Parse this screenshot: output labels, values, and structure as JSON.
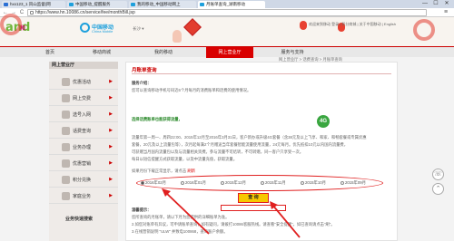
{
  "browser": {
    "tabs": [
      {
        "label": "hxx123_1 风山监督(网",
        "favicon_color": "#2a6fd4",
        "active": false
      },
      {
        "label": "中国移动_提醒服务",
        "favicon_color": "#1ea0dc",
        "active": false
      },
      {
        "label": "我的移动_中国移动网上",
        "favicon_color": "#1ea0dc",
        "active": false
      },
      {
        "label": "月账单查询_湖南移动",
        "favicon_color": "#1ea0dc",
        "active": true
      }
    ],
    "window_buttons": [
      "—",
      "☐",
      "✕"
    ],
    "address": "https://www.hn.10086.cn/service/fee/monthBill.jsp",
    "nav_back": "←",
    "nav_forward": "→",
    "nav_reload": "C",
    "menu_icon": "≡"
  },
  "header": {
    "logo_and": "and",
    "logo_he": "和",
    "brand_cn": "中国移动",
    "brand_en": "China Mobile",
    "region": "长沙 ▾",
    "top_links": "欢迎来到移动    登录  |  积分商城  |  关于中国移动  |  English"
  },
  "navbar": {
    "items": [
      "首页",
      "移动商城",
      "我的移动",
      "网上营业厅",
      "服务与支持"
    ],
    "active_index": 3,
    "accent": "#d90000"
  },
  "sidebar": {
    "title": "网上营业厅",
    "items": [
      {
        "label": "优惠活动",
        "icon": "gift-icon"
      },
      {
        "label": "网上交费",
        "icon": "payment-icon"
      },
      {
        "label": "选号入网",
        "icon": "sim-icon"
      },
      {
        "label": "话费查询",
        "icon": "bill-icon"
      },
      {
        "label": "业务办理",
        "icon": "service-icon"
      },
      {
        "label": "优惠营销",
        "icon": "promo-icon"
      },
      {
        "label": "积分兑换",
        "icon": "points-icon"
      },
      {
        "label": "家庭业务",
        "icon": "home-icon"
      }
    ],
    "bottom_title": "业务快速搜索"
  },
  "breadcrumb": "网上营业厅 > 话费查询 > 月账单查询",
  "content": {
    "title": "月账单查询",
    "intro_label": "服务介绍：",
    "intro_line1": "您可以查询移动手机号码近6个月每月的消费账单和话费的使用情况。",
    "promo_line": "选择话费账单也能获得流量，",
    "promo_tag": "4G",
    "para_line1": "流量年第一周一、周四22:00、2015年12月至2016年3月31日，客户新办或升级4G套餐（含38元及以上飞享、和家、和畅套餐或专属优惠",
    "para_line2": "套餐，20元及以上流量包等），次月起每满2个月赠送当年套餐智能流量使用流量，24元每月。优先抵扣10元以内国内流量费，",
    "para_line3": "可获赠当月国内流量包以及与流量相关资费。参与流量不可结转，不可转赠，同一客户只享受一次。",
    "para_line4": "每日以短信提醒方式获取流量，以及中流量充值，获取流量。",
    "select_prompt": "如果月份下载正常显示，请点击",
    "select_link": "刷新",
    "months": [
      "2016年02月",
      "2016年01月",
      "2015年12月",
      "2015年11月",
      "2015年10月",
      "2015年09月"
    ],
    "selected_month_index": 0,
    "query_button": "查 询",
    "tips_title": "温馨提示：",
    "tips_line1": "您所查询的月账单，请以下月为您提供的详细账单为准。",
    "tips_line2": "2.如您对账单有异议，可申请账单查询，如有疑问，请拨打10086客服热线。请查看\"安全提醒\"。如已查询请点击\"刷\"。",
    "tips_line3": "3.在线营销说明 \"ULW\" 并致电100868，查询账户余额。"
  }
}
